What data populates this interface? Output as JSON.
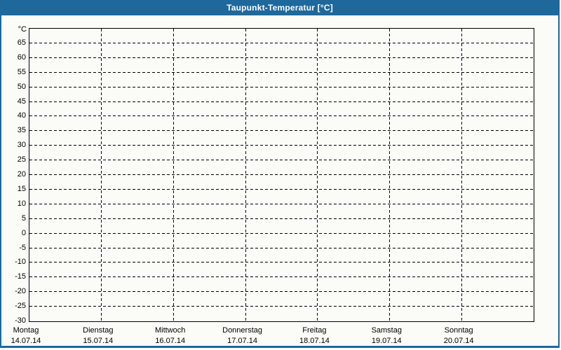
{
  "window": {
    "title": "Taupunkt-Temperatur [°C]"
  },
  "colors": {
    "titlebar": "#1e689b",
    "window_border": "#1e689b",
    "background": "#fbfcf8",
    "grid": "#000000",
    "text": "#000000",
    "title_text": "#ffffff"
  },
  "chart_data": {
    "type": "line",
    "title": "Taupunkt-Temperatur [°C]",
    "ylabel": "°C",
    "unit_label": "°C",
    "ylim": [
      -30,
      70
    ],
    "y_tick_step": 5,
    "y_ticks": [
      65,
      60,
      55,
      50,
      45,
      40,
      35,
      30,
      25,
      20,
      15,
      10,
      5,
      0,
      -5,
      -10,
      -15,
      -20,
      -25,
      -30
    ],
    "x_days": [
      {
        "day": "Montag",
        "date": "14.07.14"
      },
      {
        "day": "Dienstag",
        "date": "15.07.14"
      },
      {
        "day": "Mittwoch",
        "date": "16.07.14"
      },
      {
        "day": "Donnerstag",
        "date": "17.07.14"
      },
      {
        "day": "Freitag",
        "date": "18.07.14"
      },
      {
        "day": "Samstag",
        "date": "19.07.14"
      },
      {
        "day": "Sonntag",
        "date": "20.07.14"
      }
    ],
    "grid": "dashed",
    "legend": "none",
    "series": []
  }
}
